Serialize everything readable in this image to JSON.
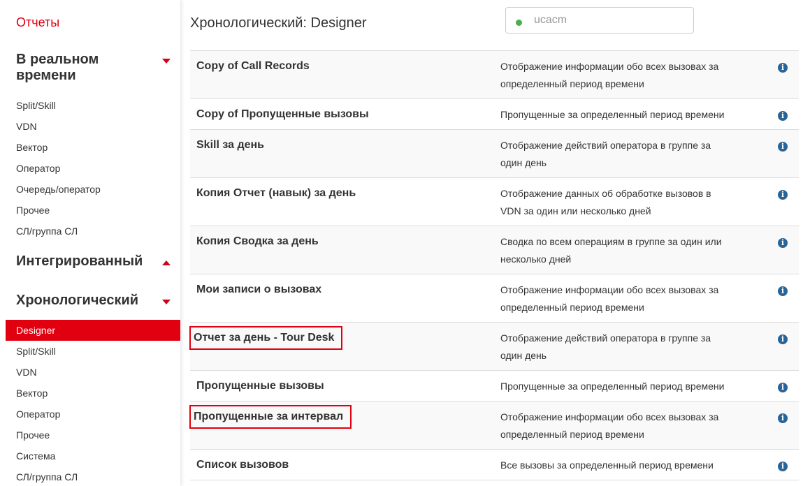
{
  "colors": {
    "accent": "#e0000f",
    "info": "#2a6496",
    "status_dot": "#4cae4c"
  },
  "sidebar": {
    "brand": "Отчеты",
    "sections": [
      {
        "title": "В реальном времени",
        "caret": "caret-down",
        "items": [
          "Split/Skill",
          "VDN",
          "Вектор",
          "Оператор",
          "Очередь/оператор",
          "Прочее",
          "СЛ/группа СЛ"
        ]
      },
      {
        "title": "Интегрированный",
        "caret": "caret-up",
        "items": []
      },
      {
        "title": "Хронологический",
        "caret": "caret-down",
        "items": [
          "Designer",
          "Split/Skill",
          "VDN",
          "Вектор",
          "Оператор",
          "Прочее",
          "Система",
          "СЛ/группа СЛ"
        ],
        "active_item": "Designer"
      }
    ]
  },
  "header": {
    "title": "Хронологический: Designer",
    "search": {
      "placeholder": "ucacm",
      "status_icon": "status-dot-icon"
    }
  },
  "reports": [
    {
      "name": "Copy of Call Records",
      "desc_lines": [
        "Отображение информации обо всех вызовах за",
        "определенный период времени"
      ],
      "highlighted": false
    },
    {
      "name": "Copy of Пропущенные вызовы",
      "desc_lines": [
        "Пропущенные за определенный период времени"
      ],
      "highlighted": false
    },
    {
      "name": "Skill за день",
      "desc_lines": [
        "Отображение действий оператора в группе за",
        "один день"
      ],
      "highlighted": false
    },
    {
      "name": "Копия Отчет (навык) за день",
      "desc_lines": [
        "Отображение данных об обработке вызовов в",
        "VDN за один или несколько дней"
      ],
      "highlighted": false
    },
    {
      "name": "Копия Сводка за день",
      "desc_lines": [
        "Сводка по всем операциям в группе за один или",
        "несколько дней"
      ],
      "highlighted": false
    },
    {
      "name": "Мои записи о вызовах",
      "desc_lines": [
        "Отображение информации обо всех вызовах за",
        "определенный период времени"
      ],
      "highlighted": false
    },
    {
      "name": "Отчет за день - Tour Desk",
      "desc_lines": [
        "Отображение действий оператора в группе за",
        "один день"
      ],
      "highlighted": true
    },
    {
      "name": "Пропущенные вызовы",
      "desc_lines": [
        "Пропущенные за определенный период времени"
      ],
      "highlighted": false
    },
    {
      "name": "Пропущенные за интервал",
      "desc_lines": [
        "Отображение информации обо всех вызовах за",
        "определенный период времени"
      ],
      "highlighted": true
    },
    {
      "name": "Список вызовов",
      "desc_lines": [
        "Все вызовы за определенный период времени"
      ],
      "highlighted": false
    }
  ],
  "info_icon": {
    "glyph": "i",
    "name": "info-icon"
  }
}
